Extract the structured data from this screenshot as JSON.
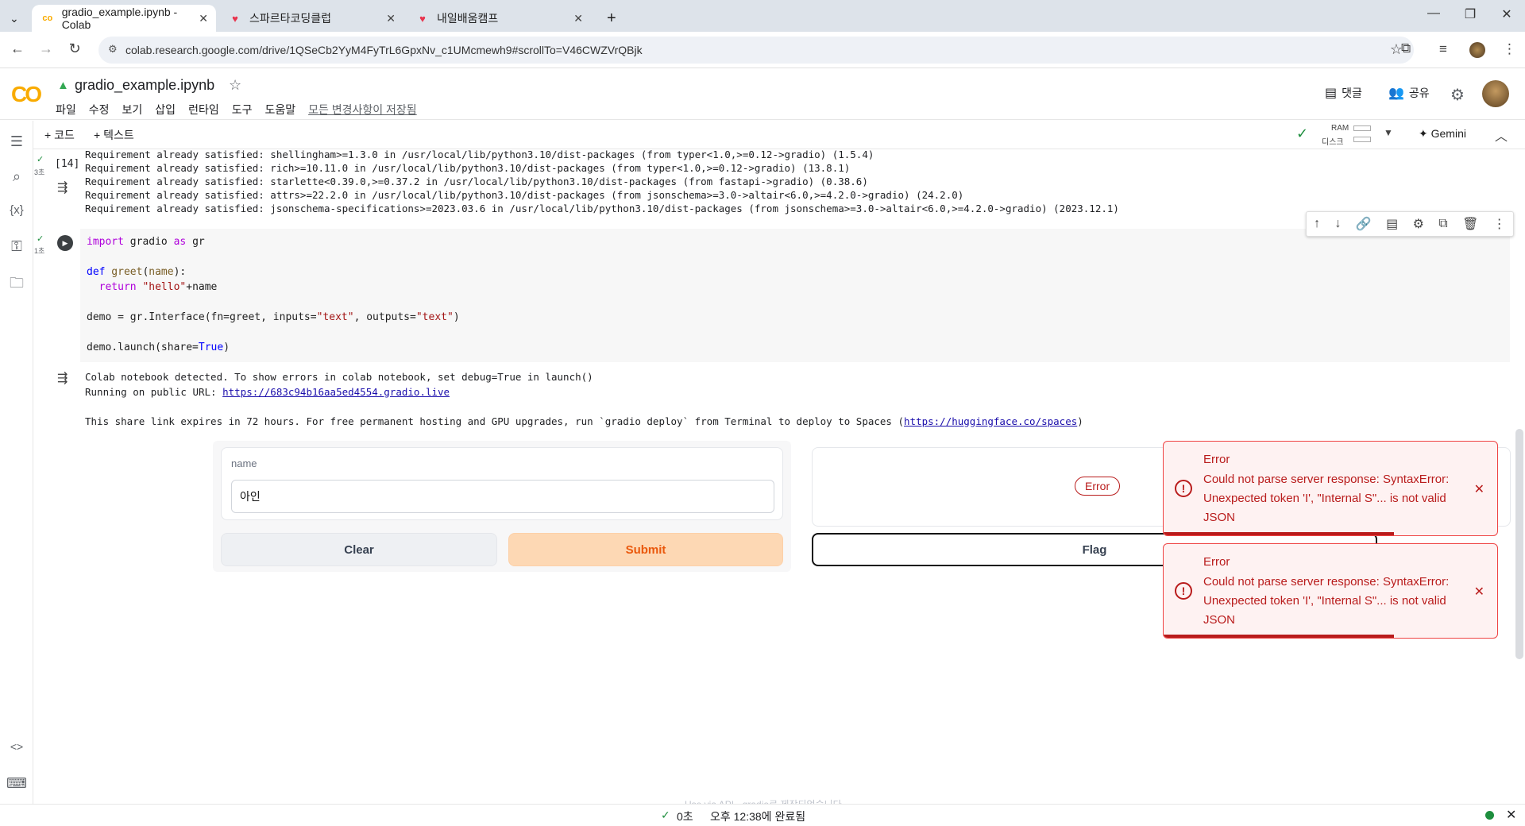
{
  "browser": {
    "tabs": [
      {
        "title": "gradio_example.ipynb - Colab",
        "active": true
      },
      {
        "title": "스파르타코딩클럽",
        "active": false
      },
      {
        "title": "내일배움캠프",
        "active": false
      }
    ],
    "url": "colab.research.google.com/drive/1QSeCb2YyM4FyTrL6GpxNv_c1UMcmewh9#scrollTo=V46CWZVrQBjk"
  },
  "colab": {
    "notebook_title": "gradio_example.ipynb",
    "menu": [
      "파일",
      "수정",
      "보기",
      "삽입",
      "런타임",
      "도구",
      "도움말"
    ],
    "saved_status": "모든 변경사항이 저장됨",
    "comments_label": "댓글",
    "share_label": "공유",
    "toolbar": {
      "add_code": "+ 코드",
      "add_text": "+ 텍스트",
      "ram": "RAM",
      "disk": "디스크",
      "gemini": "Gemini"
    }
  },
  "cell1": {
    "exec_count": "[14]",
    "time": "3초",
    "output_lines": [
      "Requirement already satisfied: shellingham>=1.3.0 in /usr/local/lib/python3.10/dist-packages (from typer<1.0,>=0.12->gradio) (1.5.4)",
      "Requirement already satisfied: rich>=10.11.0 in /usr/local/lib/python3.10/dist-packages (from typer<1.0,>=0.12->gradio) (13.8.1)",
      "Requirement already satisfied: starlette<0.39.0,>=0.37.2 in /usr/local/lib/python3.10/dist-packages (from fastapi->gradio) (0.38.6)",
      "Requirement already satisfied: attrs>=22.2.0 in /usr/local/lib/python3.10/dist-packages (from jsonschema>=3.0->altair<6.0,>=4.2.0->gradio) (24.2.0)",
      "Requirement already satisfied: jsonschema-specifications>=2023.03.6 in /usr/local/lib/python3.10/dist-packages (from jsonschema>=3.0->altair<6.0,>=4.2.0->gradio) (2023.12.1)"
    ]
  },
  "cell2": {
    "time": "1초",
    "code": {
      "l1_kw": "import",
      "l1_rest": " gradio ",
      "l1_as": "as",
      "l1_end": " gr",
      "l2_kw": "def",
      "l2_fn": " greet",
      "l2_rest": "(",
      "l2_arg": "name",
      "l2_end": "):",
      "l3_kw": "  return",
      "l3_str": " \"hello\"",
      "l3_end": "+name",
      "l4_a": "demo = gr.Interface(fn=greet, inputs=",
      "l4_s1": "\"text\"",
      "l4_b": ", outputs=",
      "l4_s2": "\"text\"",
      "l4_c": ")",
      "l5_a": "demo.launch(share=",
      "l5_b": "True",
      "l5_c": ")"
    },
    "output": {
      "line1": "Colab notebook detected. To show errors in colab notebook, set debug=True in launch()",
      "line2_prefix": "Running on public URL: ",
      "line2_link": "https://683c94b16aa5ed4554.gradio.live",
      "line3_prefix": "This share link expires in 72 hours. For free permanent hosting and GPU upgrades, run `gradio deploy` from Terminal to deploy to Spaces (",
      "line3_link": "https://huggingface.co/spaces",
      "line3_suffix": ")"
    }
  },
  "gradio": {
    "input_label": "name",
    "input_value": "아인",
    "clear_label": "Clear",
    "submit_label": "Submit",
    "output_badge": "Error",
    "flag_label": "Flag",
    "footer": "Use via API  ·  gradio로 제작되었습니다",
    "toasts": [
      {
        "title": "Error",
        "message": "Could not parse server response: SyntaxError: Unexpected token 'I', \"Internal S\"... is not valid JSON",
        "progress": 0.69
      },
      {
        "title": "Error",
        "message": "Could not parse server response: SyntaxError: Unexpected token 'I', \"Internal S\"... is not valid JSON",
        "progress": 0.69
      }
    ]
  },
  "status": {
    "elapsed": "0초",
    "completed": "오후 12:38에 완료됨"
  }
}
